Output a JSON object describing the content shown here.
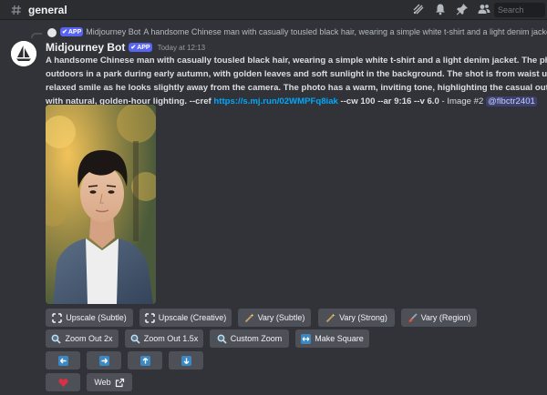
{
  "channel": {
    "name": "general"
  },
  "search": {
    "placeholder": "Search"
  },
  "reply": {
    "badge": "APP",
    "author": "Midjourney Bot",
    "text": "A handsome Chinese man with casually tousled black hair, wearing a simple white t-shirt and a light denim jacket. T"
  },
  "message": {
    "author": "Midjourney Bot",
    "badge": "APP",
    "timestamp": "Today at 12:13",
    "lines": [
      "A handsome Chinese man with casually tousled black hair, wearing a simple white t-shirt and a light denim jacket. The photo",
      "outdoors in a park during early autumn, with golden leaves and soft sunlight in the background. The shot is from waist up, cap",
      "relaxed smile as he looks slightly away from the camera. The photo has a warm, inviting tone, highlighting the casual outdoor"
    ],
    "last_line_prefix": "with natural, golden-hour lighting. --cref ",
    "link": "https://s.mj.run/02WMPFq8iak",
    "last_line_params": " --cw 100 --ar 9:16 --v 6.0",
    "last_line_suffix": " - Image #2 ",
    "mention": "@flbctr2401"
  },
  "buttons": {
    "upscale_subtle": "Upscale (Subtle)",
    "upscale_creative": "Upscale (Creative)",
    "vary_subtle": "Vary (Subtle)",
    "vary_strong": "Vary (Strong)",
    "vary_region": "Vary (Region)",
    "zoom_out_2x": "Zoom Out 2x",
    "zoom_out_1_5x": "Zoom Out 1.5x",
    "custom_zoom": "Custom Zoom",
    "make_square": "Make Square",
    "web": "Web"
  },
  "colors": {
    "background": "#313338",
    "button": "#4e5058",
    "link": "#00a8fc",
    "badge": "#5865f2",
    "heart": "#dd2e44",
    "arrow": "#3b88c3"
  }
}
